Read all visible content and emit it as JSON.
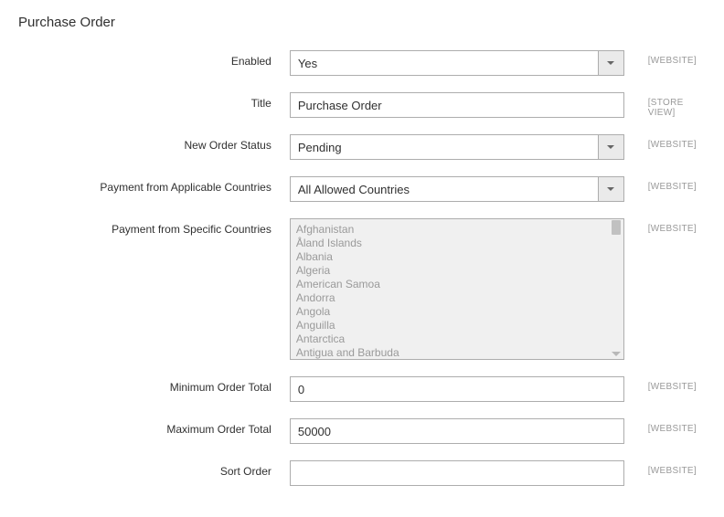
{
  "section_title": "Purchase Order",
  "scopes": {
    "website": "[WEBSITE]",
    "store_view": "[STORE VIEW]"
  },
  "fields": {
    "enabled": {
      "label": "Enabled",
      "value": "Yes"
    },
    "title": {
      "label": "Title",
      "value": "Purchase Order"
    },
    "new_order_status": {
      "label": "New Order Status",
      "value": "Pending"
    },
    "applicable_countries": {
      "label": "Payment from Applicable Countries",
      "value": "All Allowed Countries"
    },
    "specific_countries": {
      "label": "Payment from Specific Countries",
      "options": [
        "Afghanistan",
        "Åland Islands",
        "Albania",
        "Algeria",
        "American Samoa",
        "Andorra",
        "Angola",
        "Anguilla",
        "Antarctica",
        "Antigua and Barbuda"
      ]
    },
    "min_order_total": {
      "label": "Minimum Order Total",
      "value": "0"
    },
    "max_order_total": {
      "label": "Maximum Order Total",
      "value": "50000"
    },
    "sort_order": {
      "label": "Sort Order",
      "value": ""
    }
  }
}
